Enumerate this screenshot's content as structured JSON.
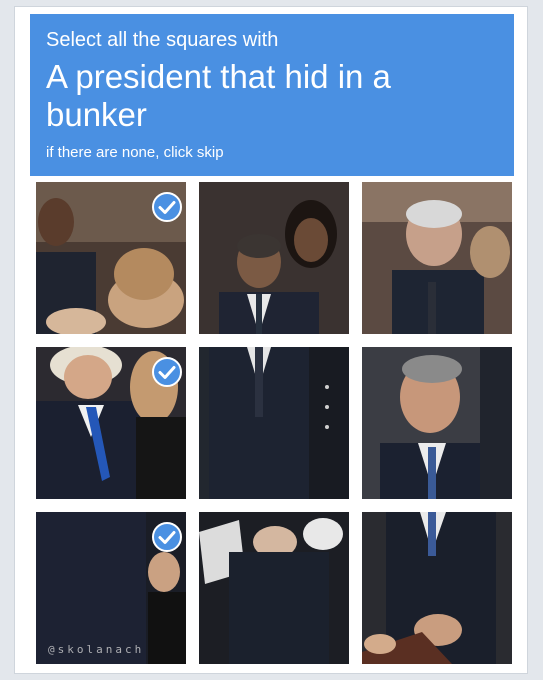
{
  "header": {
    "instruction": "Select all the squares with",
    "target": "A president that hid in a bunker",
    "hint": "if there are none, click skip"
  },
  "colors": {
    "accent": "#4a90e2",
    "check_bg": "#4a90e2"
  },
  "tiles": [
    {
      "row": 1,
      "col": 1,
      "selected": true
    },
    {
      "row": 1,
      "col": 2,
      "selected": false
    },
    {
      "row": 1,
      "col": 3,
      "selected": false
    },
    {
      "row": 2,
      "col": 1,
      "selected": true
    },
    {
      "row": 2,
      "col": 2,
      "selected": false
    },
    {
      "row": 2,
      "col": 3,
      "selected": false
    },
    {
      "row": 3,
      "col": 1,
      "selected": true
    },
    {
      "row": 3,
      "col": 2,
      "selected": false
    },
    {
      "row": 3,
      "col": 3,
      "selected": false
    }
  ],
  "check_icon": "checkmark-icon",
  "watermark": "@skolanach"
}
